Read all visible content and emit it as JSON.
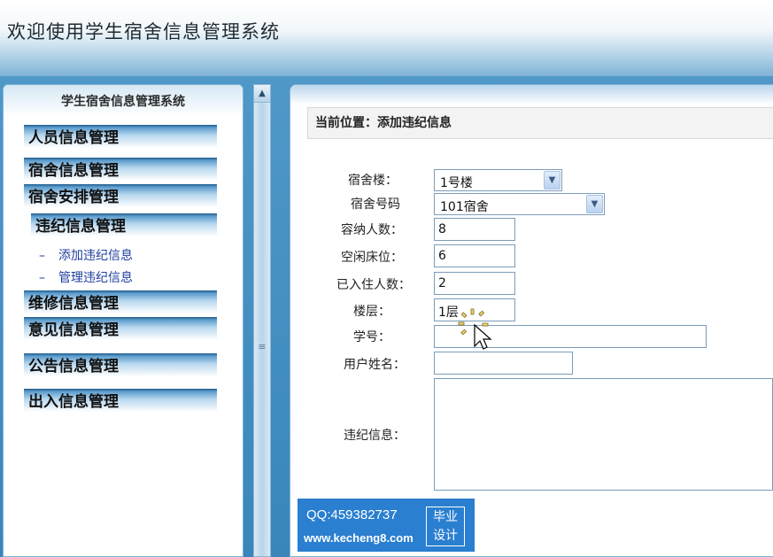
{
  "header": {
    "title": "欢迎使用学生宿舍信息管理系统"
  },
  "sidebar": {
    "title": "学生宿舍信息管理系统",
    "menus": [
      "人员信息管理",
      "宿舍信息管理",
      "宿舍安排管理",
      "违纪信息管理",
      "维修信息管理",
      "意见信息管理",
      "公告信息管理",
      "出入信息管理"
    ],
    "submenus": [
      {
        "dash": "–",
        "label": "添加违纪信息"
      },
      {
        "dash": "–",
        "label": "管理违纪信息"
      }
    ]
  },
  "main": {
    "location": "当前位置：添加违纪信息",
    "form": {
      "building": {
        "label": "宿舍楼：",
        "value": "1号楼"
      },
      "room": {
        "label": "宿舍号码",
        "value": "101宿舍"
      },
      "capacity": {
        "label": "容纳人数：",
        "value": "8"
      },
      "free_beds": {
        "label": "空闲床位：",
        "value": "6"
      },
      "occupied": {
        "label": "已入住人数：",
        "value": "2"
      },
      "floor": {
        "label": "楼层：",
        "value": "1层"
      },
      "student_id": {
        "label": "学号：",
        "value": ""
      },
      "user_name": {
        "label": "用户姓名：",
        "value": ""
      },
      "violation": {
        "label": "违纪信息：",
        "value": ""
      }
    }
  },
  "watermark": {
    "qq": "QQ:459382737",
    "site": "www.kecheng8.com",
    "badge_line1": "毕业",
    "badge_line2": "设计"
  }
}
